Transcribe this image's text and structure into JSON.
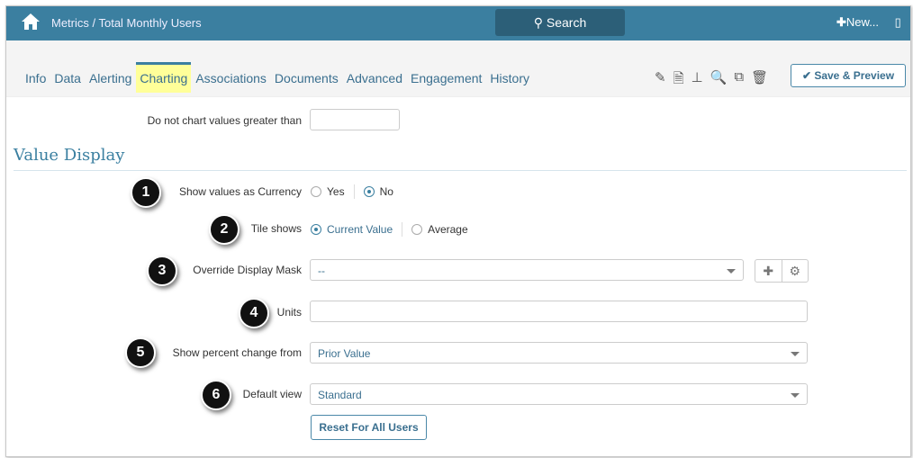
{
  "header": {
    "breadcrumb": "Metrics / Total Monthly Users",
    "search_label": "Search",
    "new_label": "New..."
  },
  "tabs": [
    "Info",
    "Data",
    "Alerting",
    "Charting",
    "Associations",
    "Documents",
    "Advanced",
    "Engagement",
    "History"
  ],
  "active_tab": "Charting",
  "toolbar": {
    "icons": [
      "edit-icon",
      "document-icon",
      "hierarchy-icon",
      "search-icon",
      "copy-icon",
      "trash-icon"
    ],
    "save_label": "Save & Preview"
  },
  "form": {
    "max_value_label": "Do not chart values greater than",
    "max_value": "",
    "section_title": "Value Display",
    "currency": {
      "badge": "1",
      "label": "Show values as Currency",
      "options": [
        "Yes",
        "No"
      ],
      "selected": "No"
    },
    "tile": {
      "badge": "2",
      "label": "Tile shows",
      "options": [
        "Current Value",
        "Average"
      ],
      "selected": "Current Value"
    },
    "mask": {
      "badge": "3",
      "label": "Override Display Mask",
      "value": "--"
    },
    "units": {
      "badge": "4",
      "label": "Units",
      "value": ""
    },
    "percent": {
      "badge": "5",
      "label": "Show percent change from",
      "value": "Prior Value"
    },
    "view": {
      "badge": "6",
      "label": "Default view",
      "value": "Standard"
    },
    "reset_label": "Reset For All Users"
  },
  "colors": {
    "header": "#3b7fa0",
    "accent": "#3a6f8f",
    "active_tab": "#ffff99"
  }
}
